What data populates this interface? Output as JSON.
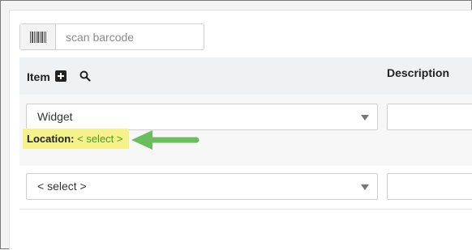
{
  "scan": {
    "placeholder": "scan barcode",
    "icon": "barcode-icon"
  },
  "table": {
    "headers": {
      "item": "Item",
      "description": "Description"
    },
    "rows": [
      {
        "item_value": "Widget",
        "location_label": "Location:",
        "location_value": "< select >"
      },
      {
        "item_value": "< select >"
      }
    ]
  },
  "annotation": {
    "arrow_color": "#6cbd5f",
    "highlight_color": "#f5f28a"
  }
}
